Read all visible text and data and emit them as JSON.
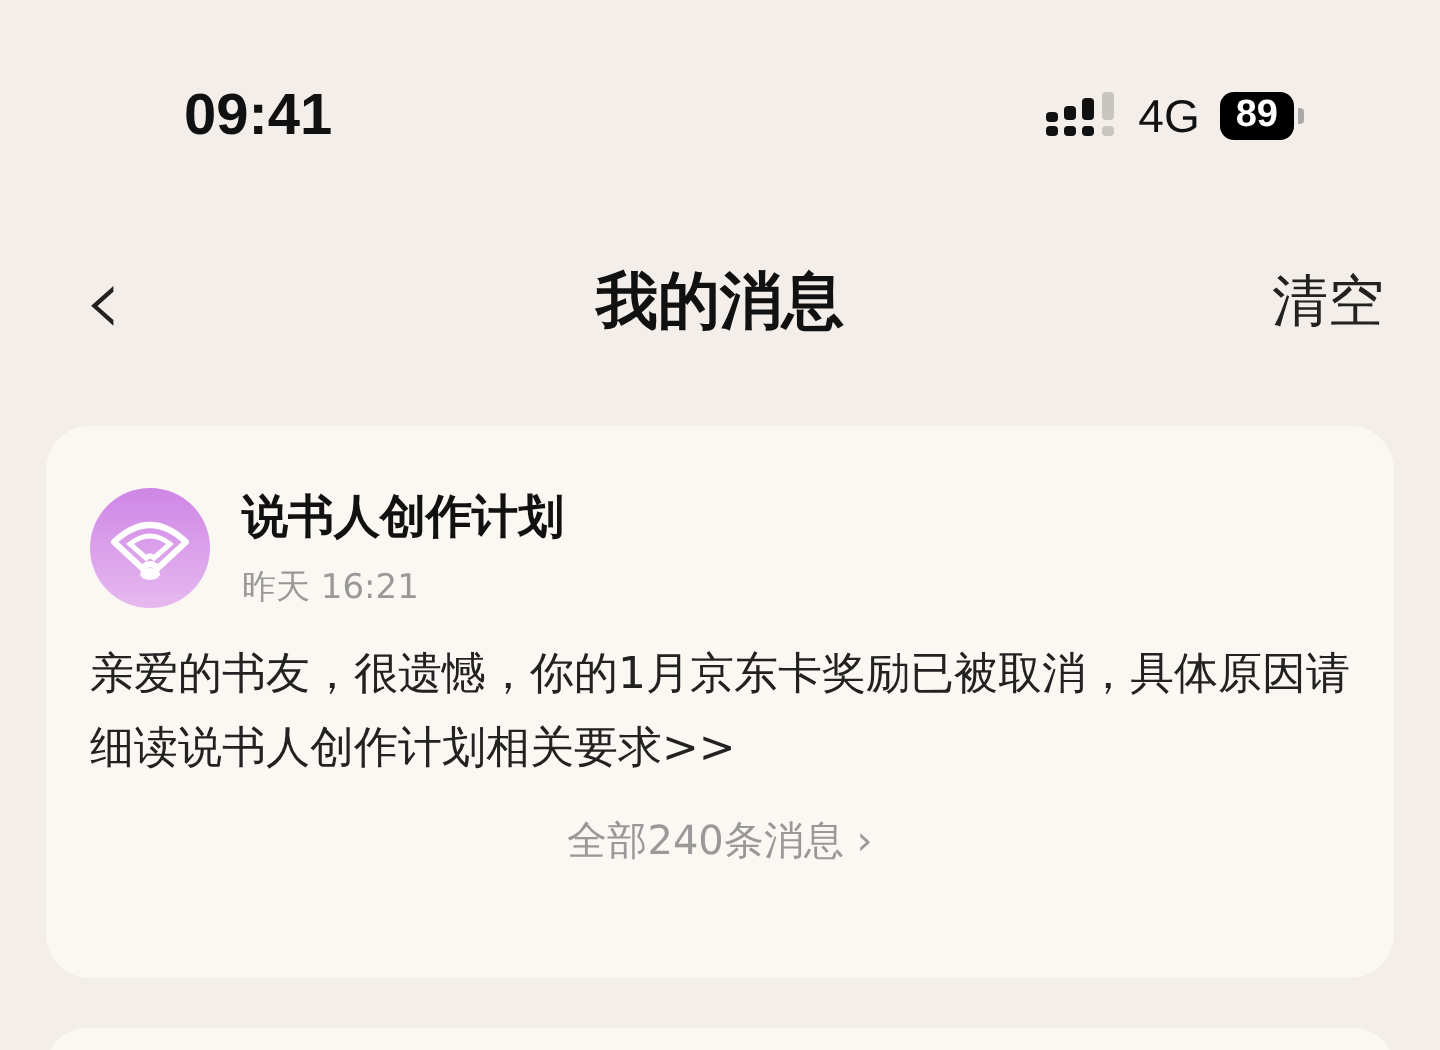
{
  "status_bar": {
    "time": "09:41",
    "network": "4G",
    "battery": "89"
  },
  "nav": {
    "back": "‹",
    "title": "我的消息",
    "action": "清空"
  },
  "messages": [
    {
      "sender": "说书人创作计划",
      "time": "昨天 16:21",
      "body": "亲爱的书友，很遗憾，你的1月京东卡奖励已被取消，具体原因请细读说书人创作计划相关要求>>",
      "more": "全部240条消息 ›"
    }
  ]
}
